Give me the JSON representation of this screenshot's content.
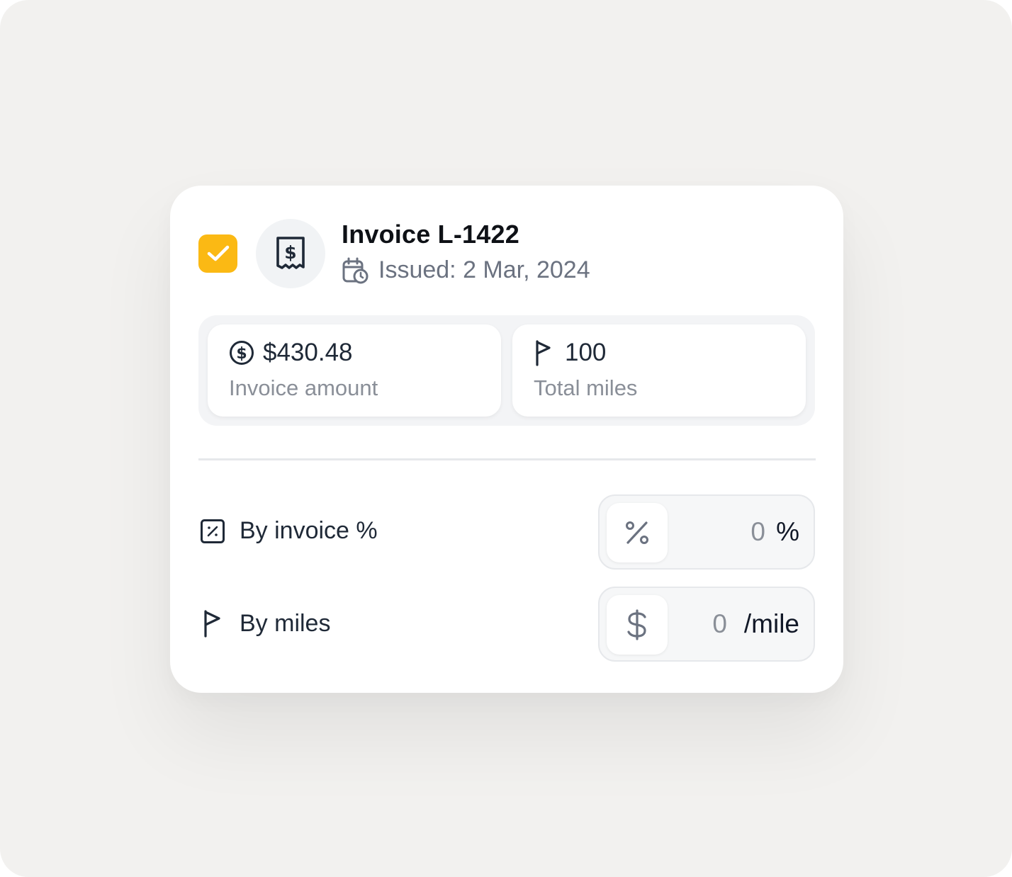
{
  "invoice": {
    "title": "Invoice L-1422",
    "issued": "Issued: 2 Mar, 2024",
    "selected": true
  },
  "stats": {
    "amount": {
      "value": "$430.48",
      "label": "Invoice amount",
      "icon": "dollar-circle-icon"
    },
    "miles": {
      "value": "100",
      "label": "Total miles",
      "icon": "flag-icon"
    }
  },
  "options": {
    "by_percent": {
      "label": "By invoice %",
      "icon": "percent-square-icon",
      "button_icon": "percent-icon",
      "value": "0",
      "unit": "%"
    },
    "by_miles": {
      "label": "By miles",
      "icon": "flag-icon",
      "button_icon": "dollar-icon",
      "value": "0",
      "unit": "/mile"
    }
  },
  "colors": {
    "accent": "#fbb914",
    "text_primary": "#0e1116",
    "text_muted": "#6b7280",
    "background": "#f2f1ef"
  }
}
